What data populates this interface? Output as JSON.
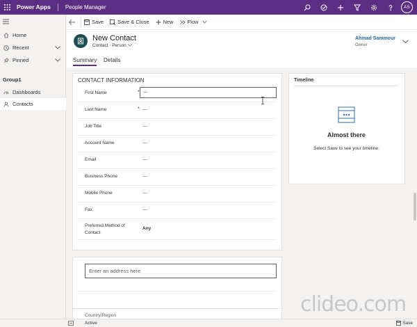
{
  "app": {
    "brand": "Power Apps",
    "name": "People Manager",
    "avatar_initials": "AS"
  },
  "topbar_icons": [
    "search-icon",
    "check-icon",
    "plus-icon",
    "filter-icon",
    "gear-icon",
    "help-icon"
  ],
  "sidebar": {
    "items": [
      {
        "label": "Home",
        "icon": "home-icon"
      },
      {
        "label": "Recent",
        "icon": "clock-icon"
      },
      {
        "label": "Pinned",
        "icon": "pin-icon"
      }
    ],
    "group_label": "Group1",
    "group_items": [
      {
        "label": "Dashboards",
        "icon": "dashboard-icon"
      },
      {
        "label": "Contacts",
        "icon": "contact-icon"
      }
    ]
  },
  "toolbar": {
    "save_label": "Save",
    "save_close_label": "Save & Close",
    "new_label": "New",
    "flow_label": "Flow"
  },
  "record": {
    "title": "New Contact",
    "entity": "Contact",
    "form_label": "Person",
    "owner_name": "Ahmad Sammour",
    "owner_label": "Owner"
  },
  "tabs": [
    {
      "label": "Summary",
      "active": true
    },
    {
      "label": "Details",
      "active": false
    }
  ],
  "contact_section": {
    "title": "CONTACT INFORMATION",
    "fields": [
      {
        "label": "First Name",
        "value": "---",
        "required": "*"
      },
      {
        "label": "Last Name",
        "value": "---",
        "required": "*"
      },
      {
        "label": "Job Title",
        "value": "---"
      },
      {
        "label": "Account Name",
        "value": "---"
      },
      {
        "label": "Email",
        "value": "---"
      },
      {
        "label": "Business Phone",
        "value": "---"
      },
      {
        "label": "Mobile Phone",
        "value": "---"
      },
      {
        "label": "Fax",
        "value": "---"
      },
      {
        "label": "Preferred Method of Contact",
        "value": "Any"
      }
    ]
  },
  "timeline": {
    "title": "Timeline",
    "heading": "Almost there",
    "message": "Select Save to see your timeline."
  },
  "address": {
    "placeholder": "Enter an address here",
    "next_label": "Country/Region"
  },
  "status": {
    "state": "Active",
    "save_label": "Save"
  },
  "watermark": "clideo.com",
  "colors": {
    "header_purple": "#5c2e83",
    "record_icon": "#1e4e52",
    "owner_link": "#2266a8"
  }
}
